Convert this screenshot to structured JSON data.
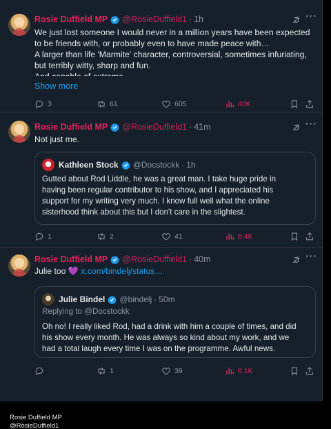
{
  "tweets": [
    {
      "author": "Rosie Duffield MP",
      "handle": "@RosieDuffield1",
      "dot": "·",
      "time": "1h",
      "lines": [
        "We just lost someone I would never in a million years have been expected",
        "to be friends with, or probably even to have made peace with…",
        "A larger than life 'Marmite' character, controversial, sometimes infuriating,",
        "but terribly witty, sharp and fun.",
        "And capable of extreme"
      ],
      "show_more": "Show more",
      "replies": "3",
      "reposts": "61",
      "likes": "605",
      "views": "40K"
    },
    {
      "author": "Rosie Duffield MP",
      "handle": "@RosieDuffield1",
      "dot": "·",
      "time": "41m",
      "text": "Not just me.",
      "quote": {
        "author": "Kathleen Stock",
        "handle": "@Docstockk",
        "dot": "·",
        "time": "1h",
        "lines": [
          "Gutted about Rod Liddle, he was a great man. I take huge pride in",
          "having been regular contributor to his show, and I appreciated his",
          "support for my writing very much. I know full well what the online",
          "sisterhood think about this but I don't care in the slightest."
        ]
      },
      "replies": "1",
      "reposts": "2",
      "likes": "41",
      "views": "8.4K"
    },
    {
      "author": "Rosie Duffield MP",
      "handle": "@RosieDuffield1",
      "dot": "·",
      "time": "40m",
      "text": "Julie too",
      "emoji": "💜",
      "link": "x.com/bindelj/status…",
      "quote": {
        "author": "Julie Bindel",
        "handle": "@bindelj",
        "dot": "·",
        "time": "50m",
        "replying_prefix": "Replying to",
        "replying_to": "@Docstockk",
        "lines": [
          "Oh no! I really liked Rod, had a drink with him a couple of times, and did",
          "his show every month. He was always so kind about my work, and we",
          "had a total laugh every time I was on the programme. Awful news."
        ]
      },
      "replies": "",
      "reposts": "1",
      "likes": "39",
      "views": "6.1K"
    }
  ],
  "footer": {
    "name": "Rosie Duffield MP",
    "handle": "@RosieDuffield1"
  },
  "colors": {
    "background": "#15202b",
    "name_red": "#e0245e",
    "link_blue": "#1d9bf0",
    "muted": "#8b98a5",
    "verified_blue": "#1d9bf0"
  },
  "icons": [
    "verified-badge-icon",
    "grok-icon",
    "more-icon",
    "reply-icon",
    "repost-icon",
    "like-icon",
    "views-icon",
    "bookmark-icon",
    "share-icon"
  ]
}
